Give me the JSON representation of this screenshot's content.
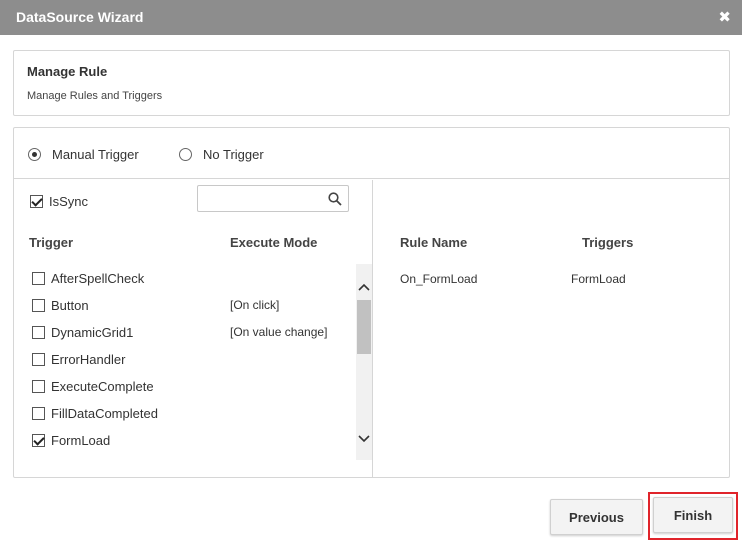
{
  "window": {
    "title": "DataSource Wizard",
    "close_glyph": "✖"
  },
  "header_panel": {
    "title": "Manage Rule",
    "subtitle": "Manage Rules and Triggers"
  },
  "trigger_mode": {
    "options": [
      {
        "label": "Manual Trigger",
        "selected": true
      },
      {
        "label": "No Trigger",
        "selected": false
      }
    ]
  },
  "left": {
    "issync_label": "IsSync",
    "issync_checked": true,
    "search_placeholder": "",
    "search_value": "",
    "columns": {
      "trigger": "Trigger",
      "mode": "Execute Mode"
    },
    "triggers": [
      {
        "label": "AfterSpellCheck",
        "mode": "",
        "checked": false
      },
      {
        "label": "Button",
        "mode": "[On click]",
        "checked": false
      },
      {
        "label": "DynamicGrid1",
        "mode": "[On value change]",
        "checked": false
      },
      {
        "label": "ErrorHandler",
        "mode": "",
        "checked": false
      },
      {
        "label": "ExecuteComplete",
        "mode": "",
        "checked": false
      },
      {
        "label": "FillDataCompleted",
        "mode": "",
        "checked": false
      },
      {
        "label": "FormLoad",
        "mode": "",
        "checked": true
      }
    ]
  },
  "right": {
    "columns": {
      "rule_name": "Rule Name",
      "triggers": "Triggers"
    },
    "rules": [
      {
        "name": "On_FormLoad",
        "triggers": "FormLoad"
      }
    ]
  },
  "footer": {
    "previous_label": "Previous",
    "finish_label": "Finish"
  },
  "colors": {
    "titlebar": "#8d8d8d",
    "highlight": "#e0242b"
  }
}
